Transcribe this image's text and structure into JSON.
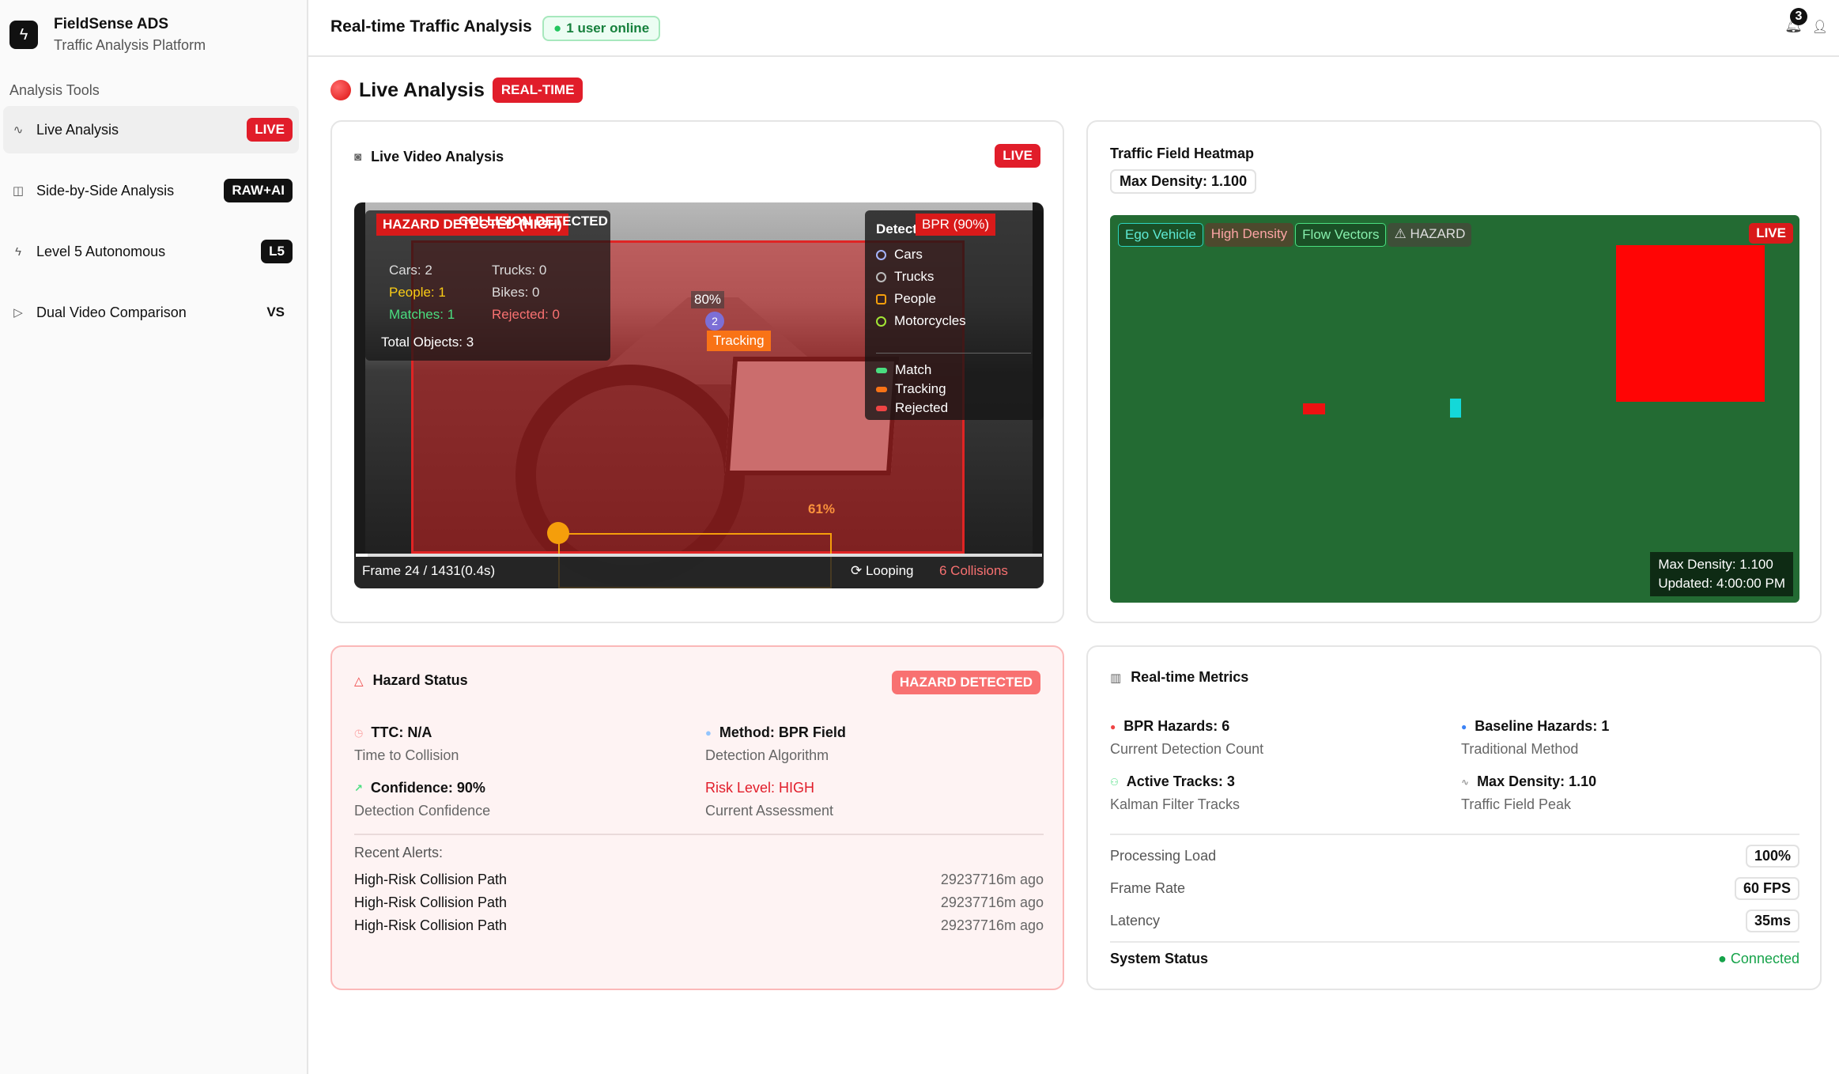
{
  "brand": {
    "title": "FieldSense ADS",
    "subtitle": "Traffic Analysis Platform"
  },
  "sidebar": {
    "section_label": "Analysis Tools",
    "items": [
      {
        "label": "Live Analysis",
        "badge": "LIVE",
        "icon": "activity-icon",
        "active": true
      },
      {
        "label": "Side-by-Side Analysis",
        "badge": "RAW+AI",
        "icon": "split-icon"
      },
      {
        "label": "Level 5 Autonomous",
        "badge": "L5",
        "icon": "bolt-icon"
      },
      {
        "label": "Dual Video Comparison",
        "badge": "VS",
        "icon": "play-icon"
      }
    ]
  },
  "header": {
    "title": "Real-time Traffic Analysis",
    "online": "1 user online",
    "notifications": "3"
  },
  "page": {
    "title": "Live Analysis",
    "badge": "REAL-TIME"
  },
  "video_card": {
    "title": "Live Video Analysis",
    "badge": "LIVE",
    "overlay": {
      "hazard_badge": "HAZARD DETECTED (HIGH)",
      "collision": "COLLISION DETECTED",
      "cars": "Cars: 2",
      "trucks": "Trucks: 0",
      "people": "People: 1",
      "bikes": "Bikes: 0",
      "matches": "Matches: 1",
      "rejected": "Rejected: 0",
      "total": "Total Objects: 3",
      "legend_title": "Detecti",
      "bpr": "BPR (90%)",
      "legend": [
        "Cars",
        "Trucks",
        "People",
        "Motorcycles"
      ],
      "legend2": [
        "Match",
        "Tracking",
        "Rejected"
      ],
      "pct_a": "80%",
      "track_id": "2",
      "tracking": "Tracking",
      "pct_b": "61%",
      "frame": "Frame 24 / 1431(0.4s)",
      "looping": "Looping",
      "collisions": "6 Collisions",
      "progress": 0.017
    }
  },
  "heatmap_card": {
    "title": "Traffic Field Heatmap",
    "max_density": "Max Density: 1.100",
    "tags": [
      "Ego Vehicle",
      "High Density",
      "Flow Vectors",
      "HAZARD"
    ],
    "live": "LIVE",
    "info_density": "Max Density: 1.100",
    "info_updated": "Updated: 4:00:00 PM"
  },
  "hazard_card": {
    "title": "Hazard Status",
    "badge": "HAZARD DETECTED",
    "ttc": "TTC: N/A",
    "ttc_desc": "Time to Collision",
    "method": "Method: BPR Field",
    "method_desc": "Detection Algorithm",
    "confidence": "Confidence: 90%",
    "confidence_desc": "Detection Confidence",
    "risk": "Risk Level: HIGH",
    "risk_desc": "Current Assessment",
    "recent_label": "Recent Alerts:",
    "alerts": [
      {
        "text": "High-Risk Collision Path",
        "time": "29237716m ago"
      },
      {
        "text": "High-Risk Collision Path",
        "time": "29237716m ago"
      },
      {
        "text": "High-Risk Collision Path",
        "time": "29237716m ago"
      }
    ]
  },
  "metrics_card": {
    "title": "Real-time Metrics",
    "bpr": "BPR Hazards: 6",
    "bpr_desc": "Current Detection Count",
    "baseline": "Baseline Hazards: 1",
    "baseline_desc": "Traditional Method",
    "tracks": "Active Tracks: 3",
    "tracks_desc": "Kalman Filter Tracks",
    "density": "Max Density: 1.10",
    "density_desc": "Traffic Field Peak",
    "rows": [
      {
        "label": "Processing Load",
        "value": "100%"
      },
      {
        "label": "Frame Rate",
        "value": "60 FPS"
      },
      {
        "label": "Latency",
        "value": "35ms"
      }
    ],
    "system_label": "System Status",
    "system_value": "Connected"
  },
  "colors": {
    "accent_red": "#e11d2a",
    "heat_bg": "#236b33",
    "success": "#16a34a"
  }
}
